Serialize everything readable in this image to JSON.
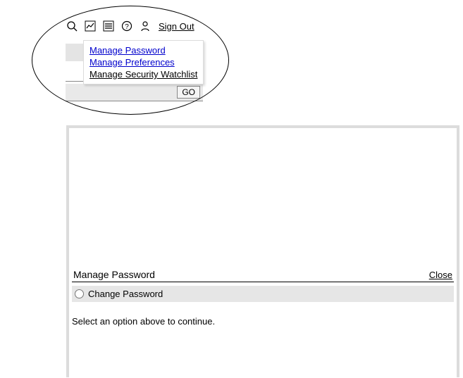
{
  "toolbar": {
    "signout_label": "Sign Out"
  },
  "icons": {
    "search": "search-icon",
    "chart": "chart-icon",
    "menu": "menu-icon",
    "help": "help-icon",
    "user": "user-icon",
    "print": "print-icon"
  },
  "dropdown": {
    "items": [
      {
        "label": "Manage Password"
      },
      {
        "label": "Manage Preferences"
      },
      {
        "label": "Manage Security Watchlist"
      }
    ]
  },
  "go_button": "GO",
  "panel": {
    "title": "Manage Password",
    "close_label": "Close",
    "option_label": "Change Password",
    "hint": "Select an option above to continue."
  }
}
